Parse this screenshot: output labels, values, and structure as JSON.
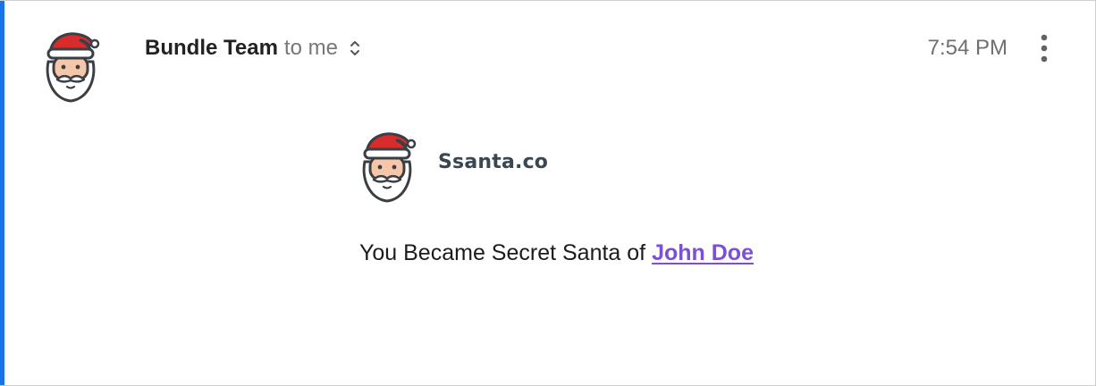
{
  "email": {
    "sender_name": "Bundle Team",
    "recipient_text": "to me",
    "timestamp": "7:54 PM",
    "sender_avatar_icon": "santa-face-icon",
    "details_icon": "expand-collapse-chevron-icon",
    "more_icon": "vertical-dots-icon"
  },
  "body": {
    "brand_name": "Ssanta.co",
    "brand_logo_icon": "santa-face-icon",
    "message_prefix": "You Became Secret Santa of ",
    "recipient_link": "John Doe"
  },
  "colors": {
    "accent_bar": "#1a73e8",
    "link": "#7b4fd6",
    "santa_hat": "#d92b2b",
    "santa_face": "#f6c6a8"
  }
}
